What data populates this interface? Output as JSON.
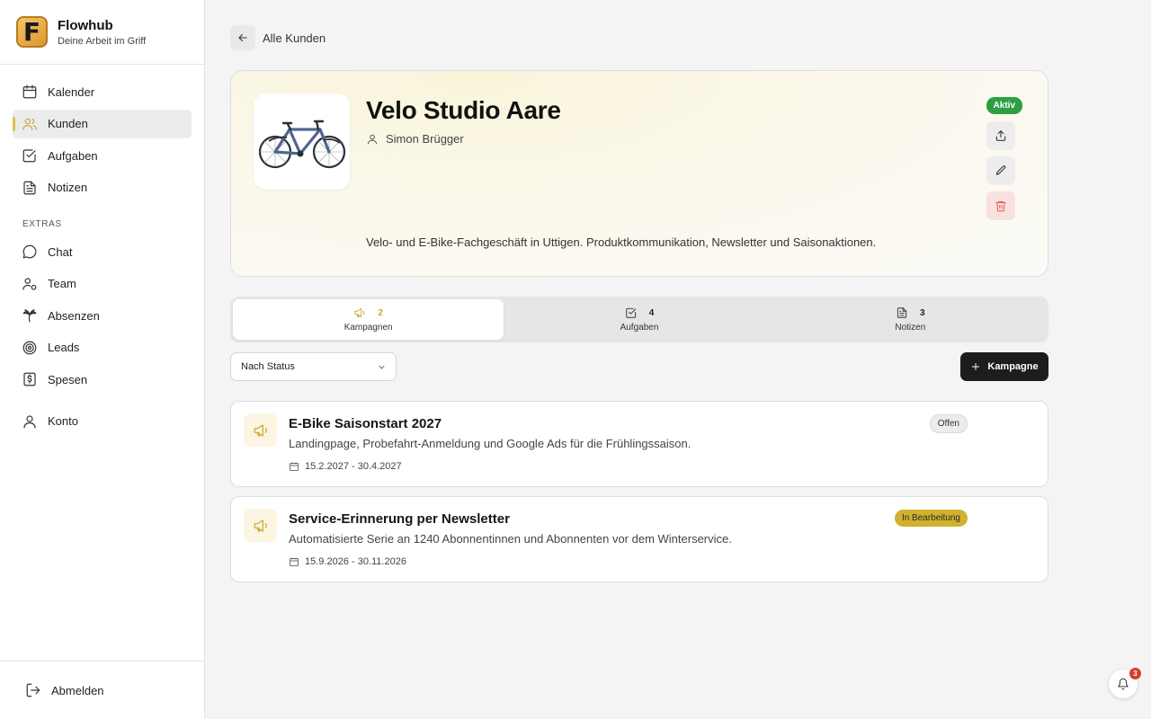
{
  "app": {
    "name": "Flowhub",
    "tagline": "Deine Arbeit im Griff",
    "logo_letter": "F"
  },
  "sidebar": {
    "items": [
      {
        "label": "Kalender",
        "icon": "calendar-icon",
        "active": false
      },
      {
        "label": "Kunden",
        "icon": "users-icon",
        "active": true
      },
      {
        "label": "Aufgaben",
        "icon": "checkbox-icon",
        "active": false
      },
      {
        "label": "Notizen",
        "icon": "document-icon",
        "active": false
      }
    ],
    "extras_label": "EXTRAS",
    "extras": [
      {
        "label": "Chat",
        "icon": "chat-icon"
      },
      {
        "label": "Team",
        "icon": "team-icon"
      },
      {
        "label": "Absenzen",
        "icon": "palm-tree-icon"
      },
      {
        "label": "Leads",
        "icon": "target-icon"
      },
      {
        "label": "Spesen",
        "icon": "receipt-icon"
      }
    ],
    "account": {
      "label": "Konto",
      "icon": "user-icon"
    },
    "logout": {
      "label": "Abmelden",
      "icon": "logout-icon"
    }
  },
  "header": {
    "back_label": "Alle Kunden"
  },
  "client": {
    "name": "Velo Studio Aare",
    "contact": "Simon Brügger",
    "description": "Velo- und E-Bike-Fachgeschäft in Uttigen. Produktkommunikation, Newsletter und Saisonaktionen.",
    "status": "Aktiv",
    "status_color": "#2e9e44",
    "image": "bicycle"
  },
  "tabs": [
    {
      "label": "Kampagnen",
      "count": "2",
      "icon": "megaphone-icon",
      "active": true
    },
    {
      "label": "Aufgaben",
      "count": "4",
      "icon": "checkbox-icon",
      "active": false
    },
    {
      "label": "Notizen",
      "count": "3",
      "icon": "document-icon",
      "active": false
    }
  ],
  "toolbar": {
    "filter_value": "Nach Status",
    "add_label": "Kampagne"
  },
  "campaigns": [
    {
      "title": "E-Bike Saisonstart 2027",
      "description": "Landingpage, Probefahrt-Anmeldung und Google Ads für die Frühlingssaison.",
      "dates": "15.2.2027 - 30.4.2027",
      "status": "Offen"
    },
    {
      "title": "Service-Erinnerung per Newsletter",
      "description": "Automatisierte Serie an 1240 Abonnentinnen und Abonnenten vor dem Winterservice.",
      "dates": "15.9.2026 - 30.11.2026",
      "status": "In Bearbeitung"
    }
  ],
  "notifications": {
    "count": "3"
  },
  "colors": {
    "accent": "#c9a93a",
    "in_progress": "#d1b12f",
    "danger": "#e25a4f",
    "dark_button": "#1d1d1d"
  }
}
